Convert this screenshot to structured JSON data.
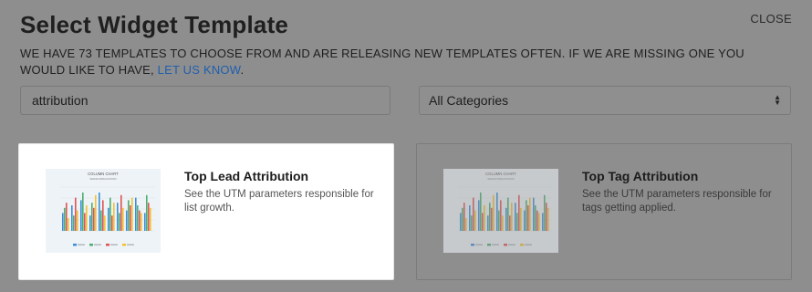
{
  "modal": {
    "title": "Select Widget Template",
    "close_label": "CLOSE",
    "intro_text": "WE HAVE 73 TEMPLATES TO CHOOSE FROM AND ARE RELEASING NEW TEMPLATES OFTEN. IF WE ARE MISSING ONE YOU WOULD LIKE TO HAVE, ",
    "intro_link": "LET US KNOW",
    "intro_end": "."
  },
  "filters": {
    "search_value": "attribution",
    "category_selected": "All Categories"
  },
  "templates": [
    {
      "title": "Top Lead Attribution",
      "description": "See the UTM parameters responsible for list growth.",
      "thumbnail": {
        "chart_title": "COLUMN CHART",
        "chart_subtitle": "SERIES BREAKDOWN"
      }
    },
    {
      "title": "Top Tag Attribution",
      "description": "See the UTM parameters responsible for tags getting applied.",
      "thumbnail": {
        "chart_title": "COLUMN CHART",
        "chart_subtitle": "SERIES BREAKDOWN"
      }
    }
  ],
  "colors": {
    "link": "#1f5fae",
    "series": [
      "#3b8fd9",
      "#4caf6e",
      "#e05454",
      "#f1c232"
    ]
  }
}
